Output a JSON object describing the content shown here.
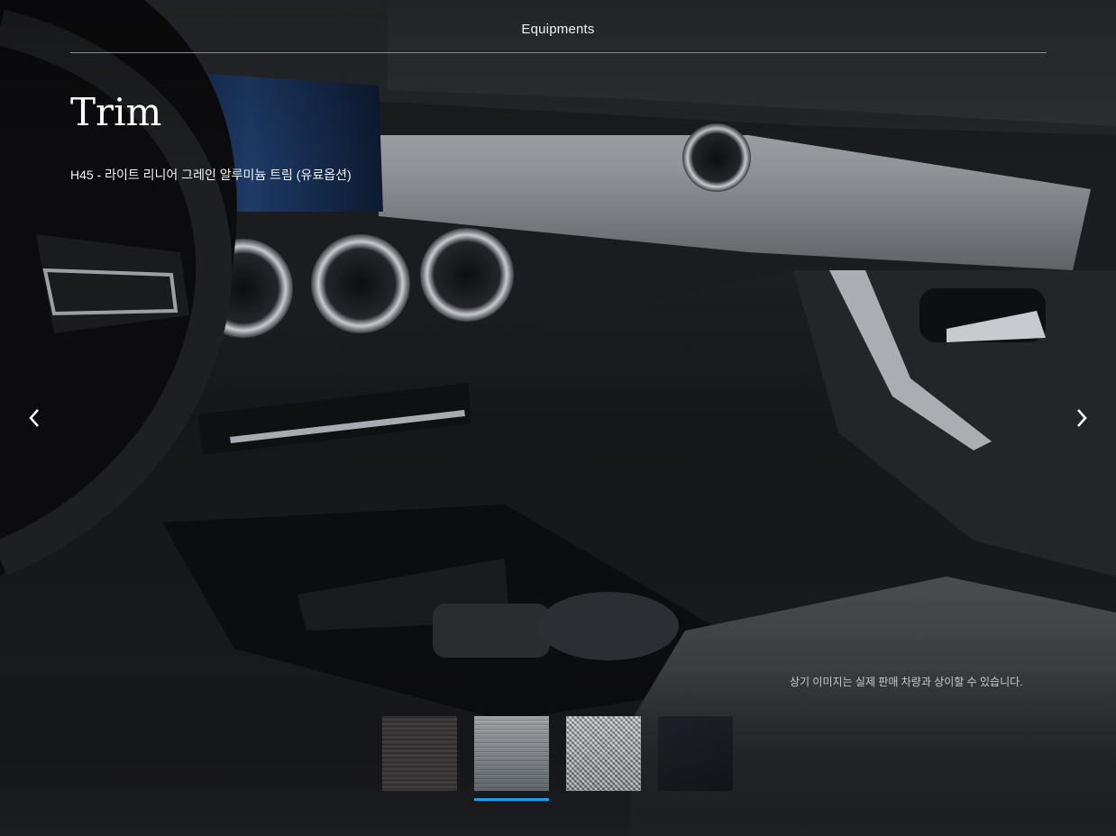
{
  "header": {
    "title": "Equipments"
  },
  "section": {
    "heading": "Trim",
    "description": "H45 - 라이트 리니어 그레인 알루미늄 트림 (유료옵션)"
  },
  "carousel": {
    "prev_icon": "chevron-left-icon",
    "next_icon": "chevron-right-icon",
    "prev_glyph": "‹",
    "next_glyph": "›"
  },
  "disclaimer": "상기 이미지는 실제 판매 차량과 상이할 수 있습니다.",
  "swatches": [
    {
      "name": "dark-wood-grain",
      "selected": false
    },
    {
      "name": "light-linear-grain-aluminium",
      "selected": true
    },
    {
      "name": "carbon-structure-silver",
      "selected": false
    },
    {
      "name": "black-piano-lacquer",
      "selected": false
    }
  ],
  "colors": {
    "background": "#111214",
    "accent_underline": "#1da1e6",
    "text": "#ffffff"
  }
}
